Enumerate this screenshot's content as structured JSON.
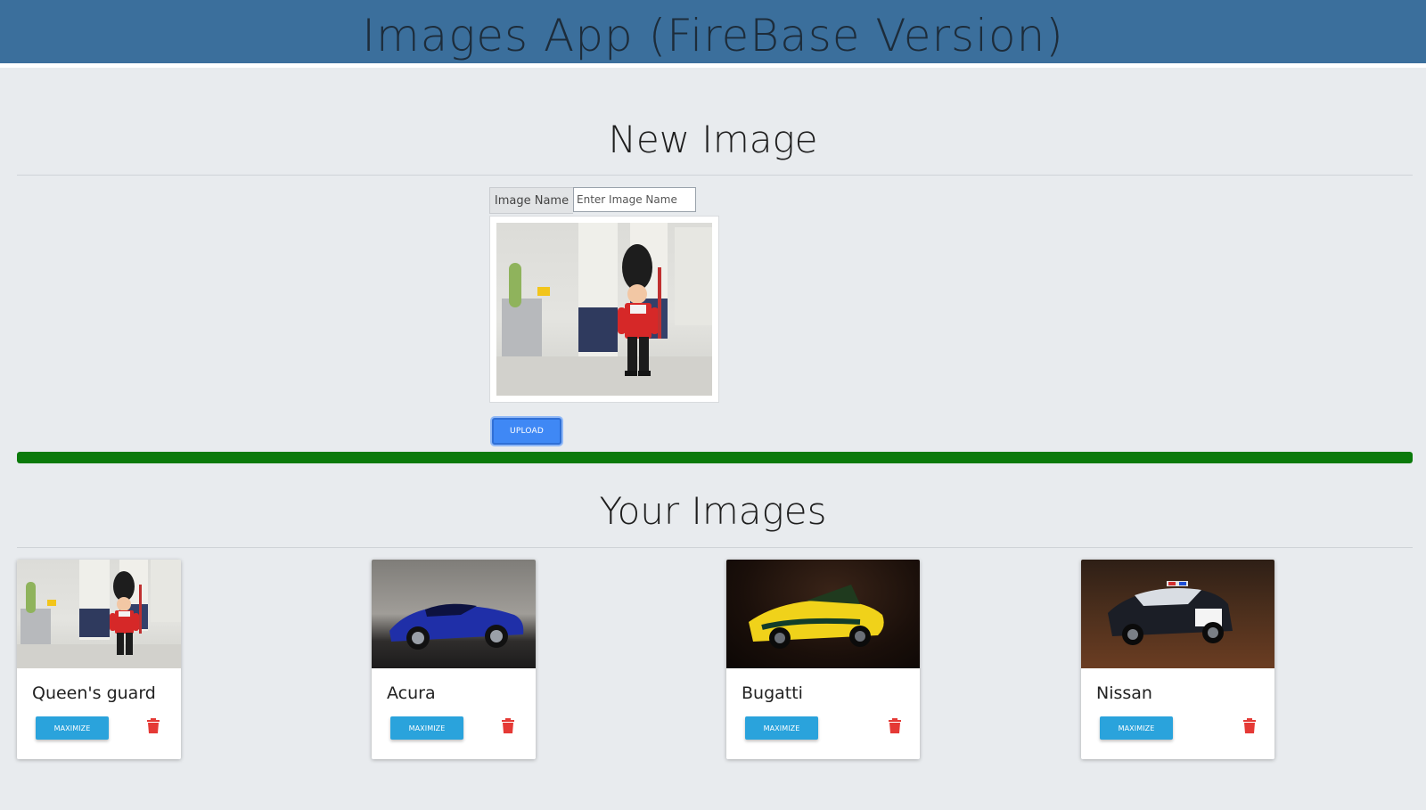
{
  "header": {
    "title": "Images App (FireBase Version)"
  },
  "new_image": {
    "title": "New Image",
    "name_label": "Image Name",
    "name_placeholder": "Enter Image Name",
    "name_value": "",
    "upload_label": "UPLOAD",
    "progress_percent": 100,
    "progress_color": "#0a7a0a"
  },
  "gallery": {
    "title": "Your Images",
    "maximize_label": "MAXIMIZE",
    "items": [
      {
        "name": "Queen's guard"
      },
      {
        "name": "Acura"
      },
      {
        "name": "Bugatti"
      },
      {
        "name": "Nissan"
      }
    ]
  },
  "colors": {
    "header_bg": "#3b6f9c",
    "page_bg": "#e8ebee",
    "upload_button": "#3f88f5",
    "maximize_button": "#2aa3dc",
    "delete_icon": "#e53935"
  }
}
